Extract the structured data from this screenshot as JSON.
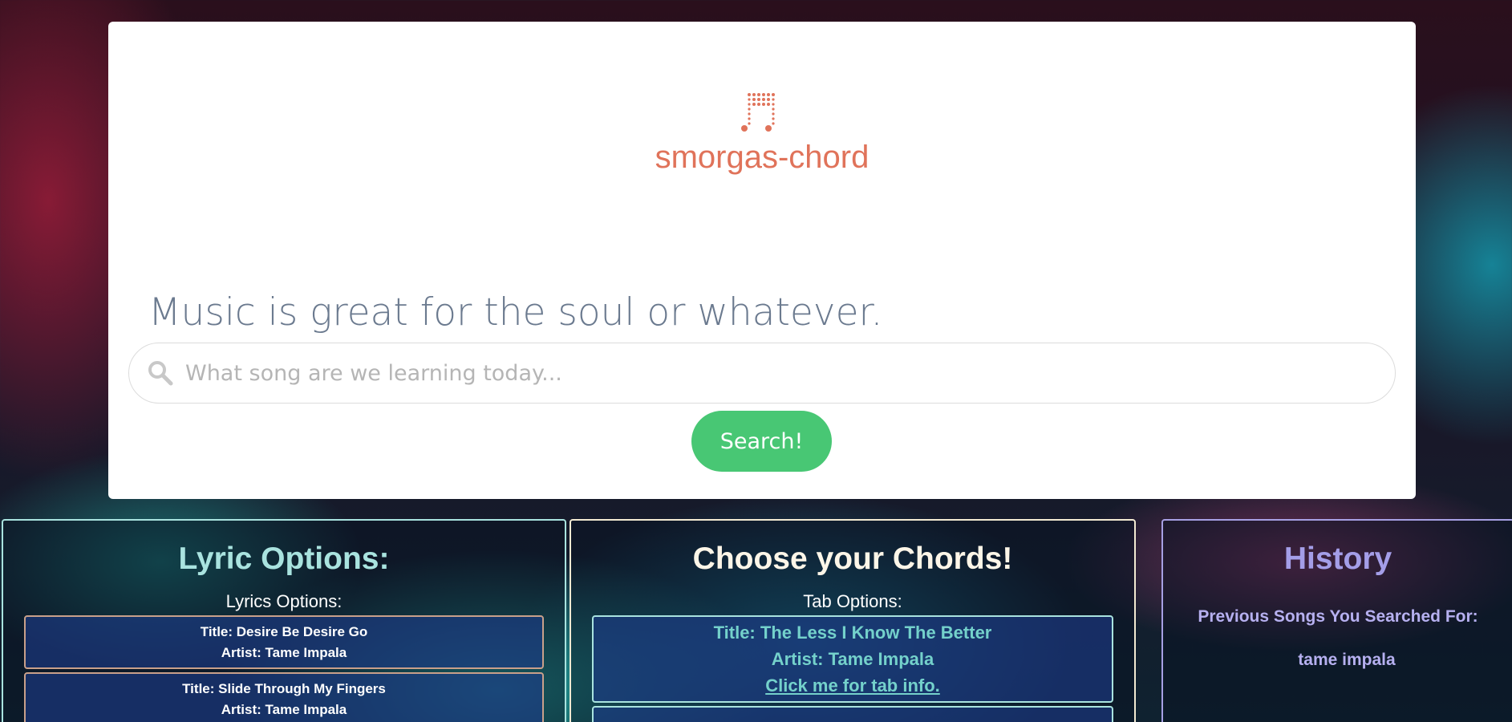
{
  "brand": {
    "name": "smorgas-chord",
    "logo_color": "#e0735a"
  },
  "hero": {
    "tagline": "Music is great for the soul or whatever.",
    "search_placeholder": "What song are we learning today...",
    "search_value": "",
    "search_button": "Search!",
    "search_icon": "search-icon"
  },
  "lyric_panel": {
    "title": "Lyric Options:",
    "subtitle": "Lyrics Options:",
    "items": [
      {
        "title": "Title: Desire Be Desire Go",
        "artist": "Artist: Tame Impala"
      },
      {
        "title": "Title: Slide Through My Fingers",
        "artist": "Artist: Tame Impala"
      }
    ]
  },
  "chords_panel": {
    "title": "Choose your Chords!",
    "subtitle": "Tab Options:",
    "items": [
      {
        "title": "Title: The Less I Know The Better",
        "artist": "Artist: Tame Impala",
        "link": "Click me for tab info."
      }
    ]
  },
  "history_panel": {
    "title": "History",
    "label": "Previous Songs You Searched For:",
    "items": [
      "tame impala"
    ]
  },
  "colors": {
    "search_button": "#48c774",
    "lyric_border": "#a9e3df",
    "chords_border": "#f3ead2",
    "history_border": "#a7a0e4"
  }
}
